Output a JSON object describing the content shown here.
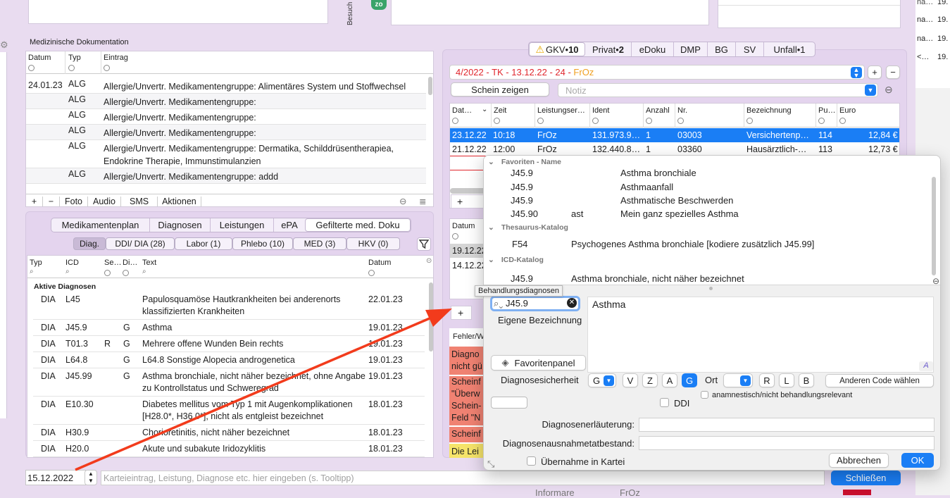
{
  "top": {
    "besuch_label": "Besuch",
    "zo_badge": "zo",
    "right_lines": [
      {
        "a": "na…",
        "b": "19."
      },
      {
        "a": "na…",
        "b": "19."
      },
      {
        "a": "<…",
        "b": "19."
      }
    ],
    "top_right_first": "19."
  },
  "med_doc": {
    "title": "Medizinische Dokumentation",
    "columns": [
      "Datum",
      "Typ",
      "Eintrag"
    ],
    "rows": [
      {
        "date": "24.01.23",
        "typ": "ALG",
        "entry": "Allergie/Unvertr. Medikamentengruppe: Alimentäres System und Stoffwechsel"
      },
      {
        "date": "",
        "typ": "ALG",
        "entry": "Allergie/Unvertr. Medikamentengruppe:"
      },
      {
        "date": "",
        "typ": "ALG",
        "entry": "Allergie/Unvertr. Medikamentengruppe:"
      },
      {
        "date": "",
        "typ": "ALG",
        "entry": "Allergie/Unvertr. Medikamentengruppe:"
      },
      {
        "date": "",
        "typ": "ALG",
        "entry": "Allergie/Unvertr. Medikamentengruppe: Dermatika, Schilddrüsentherapiea, Endokrine Therapie, Immunstimulanzien"
      },
      {
        "date": "",
        "typ": "ALG",
        "entry": "Allergie/Unvertr. Medikamentengruppe: addd"
      }
    ],
    "toolbar": {
      "add": "+",
      "remove": "−",
      "foto": "Foto",
      "audio": "Audio",
      "sms": "SMS",
      "aktionen": "Aktionen"
    }
  },
  "lower_tabs": [
    "Medikamentenplan",
    "Diagnosen",
    "Leistungen",
    "ePA",
    "Gefilterte med. Doku"
  ],
  "filter_tabs": [
    "Diag.",
    "DDI/ DIA (28)",
    "Labor (1)",
    "Phlebo (10)",
    "MED (3)",
    "HKV (0)"
  ],
  "diag_table": {
    "columns": [
      "Typ",
      "ICD",
      "Se…",
      "Di…",
      "Text",
      "Datum"
    ],
    "section": "Aktive Diagnosen",
    "rows": [
      {
        "typ": "DIA",
        "icd": "L45",
        "se": "",
        "di": "",
        "text": "Papulosquamöse Hautkrankheiten bei anderenorts klassifizierten Krankheiten",
        "date": "22.01.23"
      },
      {
        "typ": "DIA",
        "icd": "J45.9",
        "se": "",
        "di": "G",
        "text": "Asthma",
        "date": "19.01.23"
      },
      {
        "typ": "DIA",
        "icd": "T01.3",
        "se": "R",
        "di": "G",
        "text": "Mehrere offene Wunden Bein rechts",
        "date": "19.01.23"
      },
      {
        "typ": "DIA",
        "icd": "L64.8",
        "se": "",
        "di": "G",
        "text": "L64.8 Sonstige Alopecia androgenetica",
        "date": "19.01.23"
      },
      {
        "typ": "DIA",
        "icd": "J45.99",
        "se": "",
        "di": "G",
        "text": "Asthma bronchiale, nicht näher bezeichnet, ohne Angabe zu Kontrollstatus und Schweregrad",
        "date": "19.01.23"
      },
      {
        "typ": "DIA",
        "icd": "E10.30",
        "se": "",
        "di": "",
        "text": "Diabetes mellitus vom Typ 1 mit Augenkomplikationen [H28.0*, H36.0*], nicht als entgleist bezeichnet",
        "date": "18.01.23"
      },
      {
        "typ": "DIA",
        "icd": "H30.9",
        "se": "",
        "di": "",
        "text": "Chorioretinitis, nicht näher bezeichnet",
        "date": "18.01.23"
      },
      {
        "typ": "DIA",
        "icd": "H20.0",
        "se": "",
        "di": "",
        "text": "Akute und subakute Iridozyklitis",
        "date": "18.01.23"
      }
    ]
  },
  "bottom": {
    "date": "15.12.2022",
    "entry_placeholder": "Karteieintrag, Leistung, Diagnose etc. hier eingeben (s. Tooltipp)",
    "save": "Schließen",
    "under_text_a": "Informare",
    "under_text_b": "FrOz"
  },
  "billing": {
    "tabs": [
      {
        "label": "GKV",
        "count": "10"
      },
      {
        "label": "Privat",
        "count": "2"
      },
      {
        "label": "eDoku",
        "count": ""
      },
      {
        "label": "DMP",
        "count": ""
      },
      {
        "label": "BG",
        "count": ""
      },
      {
        "label": "SV",
        "count": ""
      },
      {
        "label": "Unfall",
        "count": "1"
      }
    ],
    "schein_red": "4/2022 - TK - 13.12.22 - 24 - ",
    "schein_orange": "FrOz",
    "schein_button": "Schein zeigen",
    "notiz_placeholder": "Notiz",
    "columns": [
      "Dat…",
      "Zeit",
      "Leistungser…",
      "Ident",
      "Anzahl",
      "Nr.",
      "Bezeichnung",
      "Pu…",
      "Euro"
    ],
    "rows": [
      {
        "date": "23.12.22",
        "time": "10:18",
        "ls": "FrOz",
        "ident": "131.973.9…",
        "anz": "1",
        "nr": "03003",
        "bez": "Versichertenp…",
        "pu": "114",
        "euro": "12,84 €"
      },
      {
        "date": "21.12.22",
        "time": "12:00",
        "ls": "FrOz",
        "ident": "132.440.8…",
        "anz": "1",
        "nr": "03360",
        "bez": "Hausärztlich-…",
        "pu": "113",
        "euro": "12,73 €"
      }
    ],
    "lower_col": "Datum",
    "lower_rows": [
      "19.12.22",
      "14.12.22"
    ],
    "fehler_header": "Fehler/W",
    "fehler_rows": [
      "Diagno",
      "nicht gü",
      "Scheinf",
      "\"Überw",
      "Schein-",
      "Feld \"N",
      "Scheinf",
      "Die Lei"
    ]
  },
  "popup": {
    "sections": [
      {
        "title": "Favoriten - Name",
        "items": [
          {
            "code": "J45.9",
            "short": "",
            "text": "Asthma bronchiale"
          },
          {
            "code": "J45.9",
            "short": "",
            "text": "Asthmaanfall"
          },
          {
            "code": "J45.9",
            "short": "",
            "text": "Asthmatische Beschwerden"
          },
          {
            "code": "J45.90",
            "short": "ast",
            "text": "Mein ganz spezielles Asthma"
          }
        ]
      },
      {
        "title": "Thesaurus-Katalog",
        "items": [
          {
            "code": "F54",
            "short": "",
            "text": "Psychogenes Asthma bronchiale [kodiere zusätzlich J45.99]"
          }
        ]
      },
      {
        "title": "ICD-Katalog",
        "items": [
          {
            "code": "J45.9",
            "short": "",
            "text": "Asthma bronchiale, nicht näher bezeichnet"
          }
        ]
      }
    ],
    "tooltip": "Behandlungsdiagnosen",
    "search_value": "J45.9",
    "text_value": "Asthma",
    "eigene_label": "Eigene Bezeichnung",
    "favoriten_button": "Favoritenpanel",
    "sicherheit_label": "Diagnosesicherheit",
    "sicherheit_value": "G",
    "sicherheit_buttons": [
      "V",
      "Z",
      "A",
      "G"
    ],
    "ort_label": "Ort",
    "ort_buttons": [
      "R",
      "L",
      "B"
    ],
    "anderen_code": "Anderen Code wählen",
    "ddi_label": "DDI",
    "anamnestisch_label": "anamnestisch/nicht behandlungsrelevant",
    "erlaeuterung_label": "Diagnosenerläuterung:",
    "ausnahme_label": "Diagnosenausnahmetatbestand:",
    "uebernahme_label": "Übernahme in Kartei",
    "cancel": "Abbrechen",
    "ok": "OK"
  }
}
